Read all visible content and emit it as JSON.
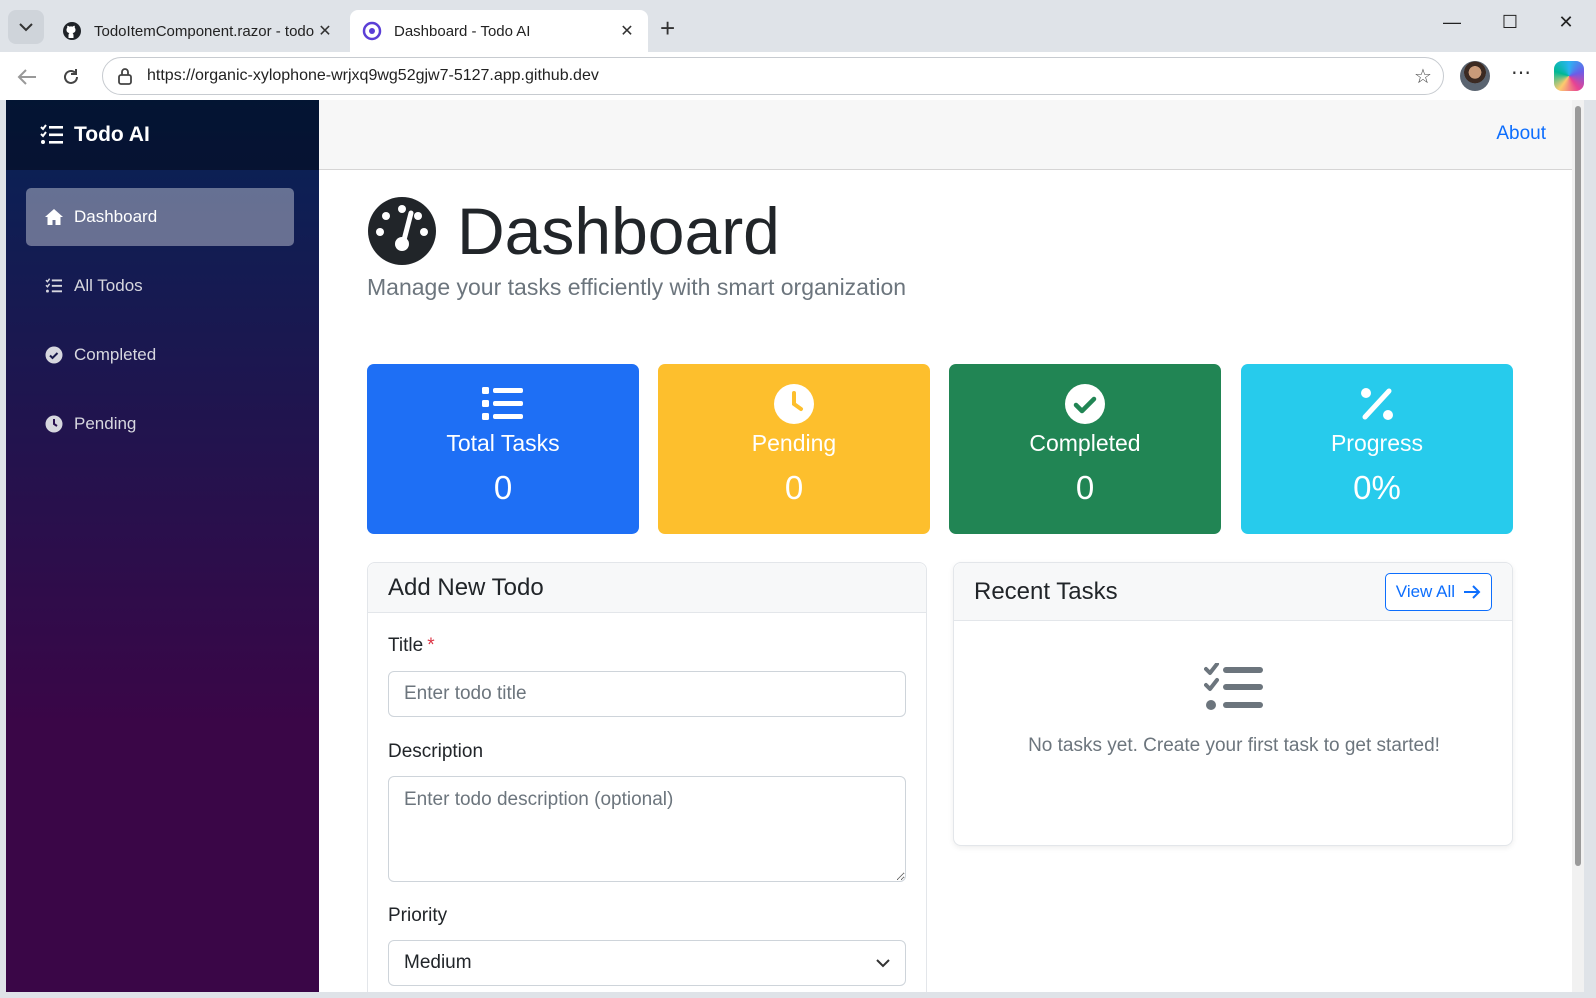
{
  "browser": {
    "tabs": [
      {
        "title": "TodoItemComponent.razor - todo",
        "active": false,
        "icon": "github-icon"
      },
      {
        "title": "Dashboard - Todo AI",
        "active": true,
        "icon": "blazor-icon"
      }
    ],
    "url": "https://organic-xylophone-wrjxq9wg52gjw7-5127.app.github.dev"
  },
  "sidebar": {
    "brand": "Todo AI",
    "items": [
      {
        "label": "Dashboard",
        "icon": "home-icon",
        "active": true
      },
      {
        "label": "All Todos",
        "icon": "list-check-icon",
        "active": false
      },
      {
        "label": "Completed",
        "icon": "check-circle-icon",
        "active": false
      },
      {
        "label": "Pending",
        "icon": "clock-icon",
        "active": false
      }
    ]
  },
  "topbar": {
    "about_label": "About"
  },
  "page": {
    "title": "Dashboard",
    "subtitle": "Manage your tasks efficiently with smart organization"
  },
  "stats": [
    {
      "label": "Total Tasks",
      "value": "0",
      "color": "#1e6ff5",
      "icon": "list-icon"
    },
    {
      "label": "Pending",
      "value": "0",
      "color": "#fdbf2d",
      "icon": "clock-icon"
    },
    {
      "label": "Completed",
      "value": "0",
      "color": "#218554",
      "icon": "check-circle-icon"
    },
    {
      "label": "Progress",
      "value": "0%",
      "color": "#27cbec",
      "icon": "percent-icon"
    }
  ],
  "add_form": {
    "title": "Add New Todo",
    "title_label": "Title",
    "required_mark": "*",
    "title_placeholder": "Enter todo title",
    "description_label": "Description",
    "description_placeholder": "Enter todo description (optional)",
    "priority_label": "Priority",
    "priority_value": "Medium"
  },
  "recent": {
    "title": "Recent Tasks",
    "view_all_label": "View All",
    "empty_text": "No tasks yet. Create your first task to get started!"
  }
}
